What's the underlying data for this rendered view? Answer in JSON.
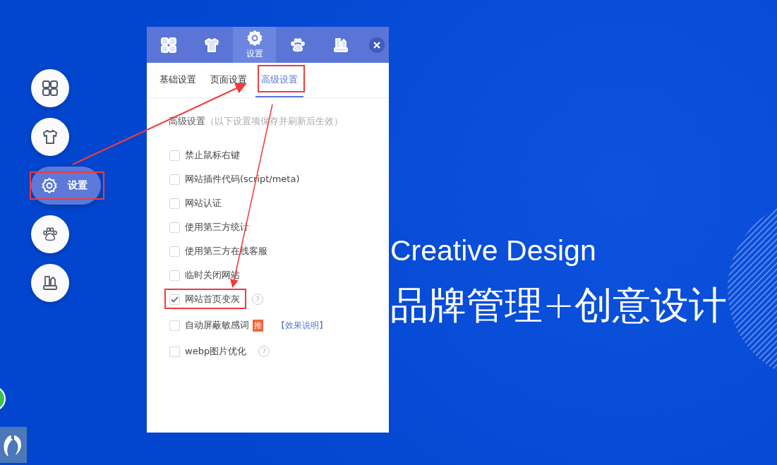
{
  "side_nav": [
    {
      "kind": "grid",
      "selected": false
    },
    {
      "kind": "shirt",
      "selected": false
    },
    {
      "kind": "gear",
      "selected": true,
      "label": "设置"
    },
    {
      "kind": "paw",
      "selected": false
    },
    {
      "kind": "holder",
      "selected": false
    }
  ],
  "panel": {
    "tabs": [
      {
        "kind": "grid",
        "selected": false
      },
      {
        "kind": "shirt",
        "selected": false
      },
      {
        "kind": "gear",
        "selected": true,
        "label": "设置"
      },
      {
        "kind": "paw",
        "selected": false
      },
      {
        "kind": "holder",
        "selected": false
      }
    ],
    "subtabs": [
      {
        "label": "基础设置",
        "selected": false
      },
      {
        "label": "页面设置",
        "selected": false
      },
      {
        "label": "高级设置",
        "selected": true
      }
    ],
    "section_title": "高级设置",
    "section_note": "（以下设置项保存并刷新后生效）",
    "options": [
      {
        "label": "禁止鼠标右键",
        "checked": false
      },
      {
        "label": "网站插件代码(script/meta)",
        "checked": false
      },
      {
        "label": "网站认证",
        "checked": false
      },
      {
        "label": "使用第三方统计",
        "checked": false
      },
      {
        "label": "使用第三方在线客服",
        "checked": false
      },
      {
        "label": "临时关闭网站",
        "checked": false
      },
      {
        "label": "网站首页变灰",
        "checked": true,
        "help": "?"
      },
      {
        "label": "自动屏蔽敏感词",
        "checked": false,
        "badge": "推",
        "link": "【效果说明】"
      },
      {
        "label": "webp图片优化",
        "checked": false,
        "help": "?"
      }
    ]
  },
  "hero": {
    "title": "Creative Design",
    "subtitle": "品牌管理+创意设计"
  }
}
